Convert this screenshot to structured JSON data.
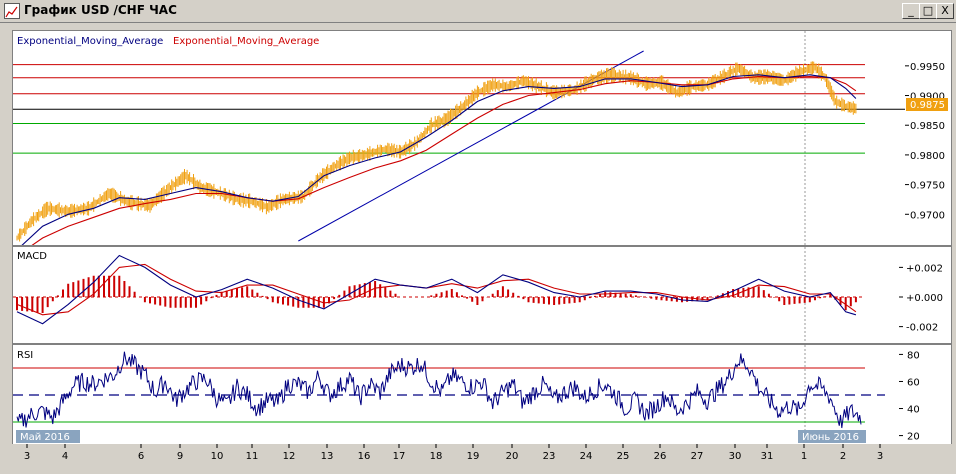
{
  "window": {
    "title": "График USD /CHF  ЧАС",
    "buttons": {
      "minimize": "_",
      "maximize": "□",
      "close": "X"
    }
  },
  "main_panel": {
    "indicator_label_1": "Exponential_Moving_Average",
    "indicator_label_2": "Exponential_Moving_Average",
    "price_ticks": [
      "0.9950",
      "0.9900",
      "0.9850",
      "0.9800",
      "0.9750",
      "0.9700"
    ],
    "current_price": "0.9875",
    "colors": {
      "price": "#f0a010",
      "ema_fast": "#000080",
      "ema_slow": "#cc0000",
      "trend": "#0000aa",
      "level_red": "#cc0000",
      "level_green": "#00aa00",
      "level_black": "#000000"
    }
  },
  "macd_panel": {
    "label": "MACD",
    "ticks": [
      "+0.002",
      "+0.000",
      "-0.002"
    ]
  },
  "rsi_panel": {
    "label": "RSI",
    "ticks": [
      "80",
      "60",
      "40",
      "20"
    ]
  },
  "date_axis": {
    "labels": [
      "3",
      "4",
      "6",
      "9",
      "10",
      "11",
      "12",
      "13",
      "16",
      "17",
      "18",
      "19",
      "20",
      "23",
      "24",
      "25",
      "26",
      "27",
      "30",
      "31",
      "1",
      "2",
      "3"
    ],
    "month_start": "Май 2016",
    "month_end": "Июнь 2016"
  },
  "chart_data": [
    {
      "type": "line",
      "title": "",
      "series": [
        {
          "name": "Exponential_Moving_Average"
        },
        {
          "name": "Exponential_Moving_Average"
        }
      ],
      "y_range": [
        0.9655,
        0.9975
      ],
      "levels_red": [
        0.9952,
        0.993,
        0.9903
      ],
      "level_black": 0.9877,
      "levels_green": [
        0.9853,
        0.9803
      ],
      "last_price": 0.9875,
      "price_path": [
        [
          0,
          0.966
        ],
        [
          6,
          0.969
        ],
        [
          12,
          0.971
        ],
        [
          20,
          0.9705
        ],
        [
          28,
          0.971
        ],
        [
          36,
          0.9735
        ],
        [
          44,
          0.972
        ],
        [
          52,
          0.9715
        ],
        [
          60,
          0.9745
        ],
        [
          66,
          0.9765
        ],
        [
          72,
          0.9745
        ],
        [
          80,
          0.9735
        ],
        [
          86,
          0.9725
        ],
        [
          92,
          0.9722
        ],
        [
          98,
          0.9712
        ],
        [
          104,
          0.9725
        ],
        [
          112,
          0.973
        ],
        [
          118,
          0.976
        ],
        [
          124,
          0.978
        ],
        [
          130,
          0.9795
        ],
        [
          136,
          0.98
        ],
        [
          144,
          0.981
        ],
        [
          150,
          0.9805
        ],
        [
          156,
          0.982
        ],
        [
          162,
          0.985
        ],
        [
          168,
          0.986
        ],
        [
          174,
          0.988
        ],
        [
          180,
          0.9905
        ],
        [
          186,
          0.9918
        ],
        [
          192,
          0.9915
        ],
        [
          198,
          0.9925
        ],
        [
          204,
          0.9915
        ],
        [
          210,
          0.9905
        ],
        [
          218,
          0.991
        ],
        [
          226,
          0.9928
        ],
        [
          232,
          0.9935
        ],
        [
          240,
          0.993
        ],
        [
          246,
          0.992
        ],
        [
          252,
          0.9922
        ],
        [
          258,
          0.9905
        ],
        [
          264,
          0.9915
        ],
        [
          270,
          0.9918
        ],
        [
          276,
          0.9932
        ],
        [
          282,
          0.9946
        ],
        [
          288,
          0.993
        ],
        [
          294,
          0.9932
        ],
        [
          300,
          0.9925
        ],
        [
          306,
          0.994
        ],
        [
          312,
          0.9948
        ],
        [
          316,
          0.993
        ],
        [
          320,
          0.989
        ],
        [
          324,
          0.9882
        ],
        [
          328,
          0.9878
        ]
      ],
      "ema_fast_path": [
        [
          0,
          0.964
        ],
        [
          10,
          0.968
        ],
        [
          20,
          0.97
        ],
        [
          30,
          0.971
        ],
        [
          40,
          0.9728
        ],
        [
          50,
          0.9725
        ],
        [
          60,
          0.9735
        ],
        [
          70,
          0.9745
        ],
        [
          80,
          0.9738
        ],
        [
          90,
          0.9728
        ],
        [
          100,
          0.9722
        ],
        [
          110,
          0.973
        ],
        [
          120,
          0.9765
        ],
        [
          130,
          0.9782
        ],
        [
          140,
          0.9795
        ],
        [
          150,
          0.9805
        ],
        [
          160,
          0.983
        ],
        [
          170,
          0.9858
        ],
        [
          180,
          0.989
        ],
        [
          190,
          0.9908
        ],
        [
          200,
          0.9915
        ],
        [
          210,
          0.9912
        ],
        [
          220,
          0.9915
        ],
        [
          230,
          0.9928
        ],
        [
          240,
          0.9928
        ],
        [
          250,
          0.9922
        ],
        [
          260,
          0.9915
        ],
        [
          270,
          0.9918
        ],
        [
          280,
          0.9932
        ],
        [
          290,
          0.9935
        ],
        [
          300,
          0.993
        ],
        [
          310,
          0.9935
        ],
        [
          318,
          0.993
        ],
        [
          324,
          0.9912
        ],
        [
          328,
          0.9895
        ]
      ],
      "ema_slow_path": [
        [
          0,
          0.963
        ],
        [
          10,
          0.966
        ],
        [
          20,
          0.968
        ],
        [
          30,
          0.9695
        ],
        [
          40,
          0.971
        ],
        [
          50,
          0.9718
        ],
        [
          60,
          0.9725
        ],
        [
          70,
          0.9735
        ],
        [
          80,
          0.9735
        ],
        [
          90,
          0.9728
        ],
        [
          100,
          0.9722
        ],
        [
          110,
          0.9726
        ],
        [
          120,
          0.9745
        ],
        [
          130,
          0.9762
        ],
        [
          140,
          0.9778
        ],
        [
          150,
          0.979
        ],
        [
          160,
          0.9808
        ],
        [
          170,
          0.9835
        ],
        [
          180,
          0.9862
        ],
        [
          190,
          0.9885
        ],
        [
          200,
          0.99
        ],
        [
          210,
          0.9905
        ],
        [
          220,
          0.991
        ],
        [
          230,
          0.992
        ],
        [
          240,
          0.9925
        ],
        [
          250,
          0.9922
        ],
        [
          260,
          0.9918
        ],
        [
          270,
          0.9918
        ],
        [
          280,
          0.9928
        ],
        [
          290,
          0.9932
        ],
        [
          300,
          0.993
        ],
        [
          310,
          0.9932
        ],
        [
          318,
          0.993
        ],
        [
          324,
          0.992
        ],
        [
          328,
          0.9908
        ]
      ],
      "trendline": [
        [
          0.9655,
          110
        ],
        [
          0.9975,
          245
        ]
      ]
    },
    {
      "type": "line",
      "title": "MACD",
      "y_range": [
        -0.0027,
        0.0027
      ],
      "macd_path": [
        [
          0,
          -0.001
        ],
        [
          10,
          -0.0018
        ],
        [
          20,
          -0.0005
        ],
        [
          30,
          0.001
        ],
        [
          40,
          0.0028
        ],
        [
          50,
          0.002
        ],
        [
          60,
          0.0008
        ],
        [
          70,
          0.0
        ],
        [
          80,
          0.0005
        ],
        [
          90,
          0.0012
        ],
        [
          100,
          0.0006
        ],
        [
          110,
          -0.0002
        ],
        [
          120,
          -0.0008
        ],
        [
          130,
          0.0002
        ],
        [
          140,
          0.0012
        ],
        [
          150,
          0.0008
        ],
        [
          160,
          0.0006
        ],
        [
          170,
          0.0012
        ],
        [
          180,
          0.0003
        ],
        [
          190,
          0.0015
        ],
        [
          200,
          0.001
        ],
        [
          210,
          0.0003
        ],
        [
          220,
          0.0
        ],
        [
          230,
          0.0004
        ],
        [
          240,
          0.0004
        ],
        [
          250,
          0.0002
        ],
        [
          260,
          -0.0002
        ],
        [
          270,
          -0.0003
        ],
        [
          280,
          0.0004
        ],
        [
          290,
          0.0012
        ],
        [
          300,
          0.0004
        ],
        [
          310,
          0.0
        ],
        [
          318,
          0.0003
        ],
        [
          324,
          -0.001
        ],
        [
          328,
          -0.0012
        ]
      ],
      "signal_path": [
        [
          0,
          -0.0005
        ],
        [
          10,
          -0.0012
        ],
        [
          20,
          -0.001
        ],
        [
          30,
          0.0002
        ],
        [
          40,
          0.002
        ],
        [
          50,
          0.0022
        ],
        [
          60,
          0.0012
        ],
        [
          70,
          0.0004
        ],
        [
          80,
          0.0003
        ],
        [
          90,
          0.0008
        ],
        [
          100,
          0.0008
        ],
        [
          110,
          0.0002
        ],
        [
          120,
          -0.0004
        ],
        [
          130,
          -0.0002
        ],
        [
          140,
          0.0006
        ],
        [
          150,
          0.0008
        ],
        [
          160,
          0.0006
        ],
        [
          170,
          0.0009
        ],
        [
          180,
          0.0006
        ],
        [
          190,
          0.0011
        ],
        [
          200,
          0.0012
        ],
        [
          210,
          0.0006
        ],
        [
          220,
          0.0002
        ],
        [
          230,
          0.0002
        ],
        [
          240,
          0.0003
        ],
        [
          250,
          0.0003
        ],
        [
          260,
          0.0
        ],
        [
          270,
          -0.0002
        ],
        [
          280,
          0.0001
        ],
        [
          290,
          0.0008
        ],
        [
          300,
          0.0007
        ],
        [
          310,
          0.0002
        ],
        [
          318,
          0.0002
        ],
        [
          324,
          -0.0005
        ],
        [
          328,
          -0.001
        ]
      ]
    },
    {
      "type": "line",
      "title": "RSI",
      "y_range": [
        16,
        84
      ],
      "levels": [
        70,
        50,
        30
      ],
      "rsi_path": [
        [
          0,
          28
        ],
        [
          6,
          36
        ],
        [
          10,
          38
        ],
        [
          14,
          33
        ],
        [
          18,
          45
        ],
        [
          22,
          57
        ],
        [
          26,
          60
        ],
        [
          30,
          58
        ],
        [
          34,
          62
        ],
        [
          38,
          65
        ],
        [
          42,
          78
        ],
        [
          46,
          72
        ],
        [
          50,
          65
        ],
        [
          54,
          52
        ],
        [
          58,
          60
        ],
        [
          62,
          46
        ],
        [
          66,
          54
        ],
        [
          70,
          60
        ],
        [
          74,
          62
        ],
        [
          78,
          48
        ],
        [
          82,
          42
        ],
        [
          86,
          56
        ],
        [
          90,
          50
        ],
        [
          94,
          40
        ],
        [
          98,
          46
        ],
        [
          102,
          44
        ],
        [
          106,
          58
        ],
        [
          110,
          58
        ],
        [
          114,
          52
        ],
        [
          118,
          64
        ],
        [
          122,
          50
        ],
        [
          126,
          56
        ],
        [
          130,
          62
        ],
        [
          134,
          48
        ],
        [
          138,
          58
        ],
        [
          142,
          52
        ],
        [
          146,
          66
        ],
        [
          150,
          72
        ],
        [
          154,
          70
        ],
        [
          158,
          74
        ],
        [
          162,
          60
        ],
        [
          166,
          52
        ],
        [
          170,
          64
        ],
        [
          174,
          60
        ],
        [
          178,
          56
        ],
        [
          182,
          60
        ],
        [
          186,
          44
        ],
        [
          190,
          52
        ],
        [
          194,
          58
        ],
        [
          198,
          44
        ],
        [
          202,
          52
        ],
        [
          206,
          58
        ],
        [
          210,
          46
        ],
        [
          214,
          52
        ],
        [
          218,
          56
        ],
        [
          222,
          48
        ],
        [
          226,
          54
        ],
        [
          230,
          58
        ],
        [
          234,
          50
        ],
        [
          238,
          40
        ],
        [
          242,
          46
        ],
        [
          246,
          36
        ],
        [
          250,
          42
        ],
        [
          254,
          50
        ],
        [
          258,
          38
        ],
        [
          262,
          44
        ],
        [
          266,
          52
        ],
        [
          270,
          46
        ],
        [
          274,
          54
        ],
        [
          278,
          62
        ],
        [
          282,
          76
        ],
        [
          286,
          72
        ],
        [
          290,
          56
        ],
        [
          294,
          46
        ],
        [
          298,
          38
        ],
        [
          302,
          42
        ],
        [
          306,
          38
        ],
        [
          310,
          58
        ],
        [
          314,
          56
        ],
        [
          318,
          48
        ],
        [
          322,
          30
        ],
        [
          326,
          38
        ],
        [
          330,
          34
        ]
      ]
    }
  ]
}
